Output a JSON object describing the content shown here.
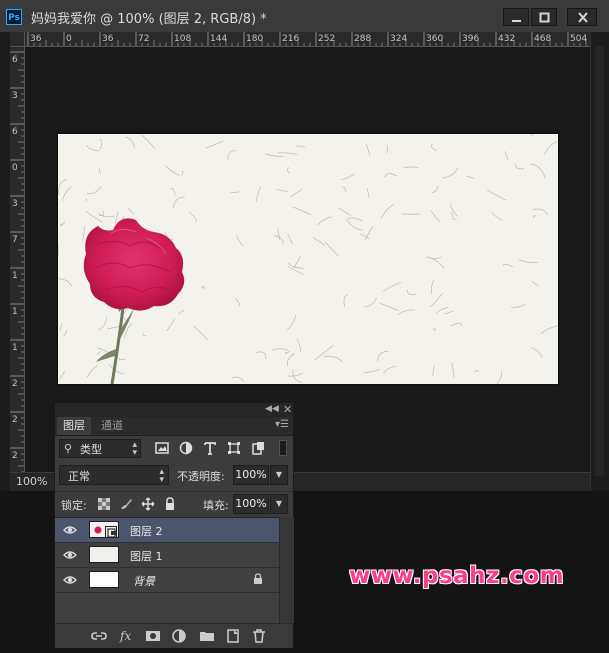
{
  "window": {
    "app_badge": "Ps",
    "title": "妈妈我爱你 @ 100% (图层 2, RGB/8) *"
  },
  "rulers": {
    "horizontal": [
      "36",
      "0",
      "36",
      "72",
      "108",
      "144",
      "180",
      "216",
      "252",
      "288",
      "324",
      "360",
      "396",
      "432",
      "468",
      "504"
    ],
    "vertical": [
      "6",
      "3",
      "6",
      "0",
      "3",
      "7",
      "1",
      "1",
      "1",
      "2",
      "2",
      "2",
      "3"
    ]
  },
  "status": {
    "zoom": "100%"
  },
  "layers_panel": {
    "tabs": [
      {
        "label": "图层",
        "active": true
      },
      {
        "label": "通道",
        "active": false
      }
    ],
    "filter": {
      "label": "类型"
    },
    "blend_mode": "正常",
    "opacity_label": "不透明度:",
    "opacity_value": "100%",
    "lock_label": "锁定:",
    "fill_label": "填充:",
    "fill_value": "100%",
    "layers": [
      {
        "name": "图层 2",
        "selected": true,
        "visible": true,
        "smart_object": true
      },
      {
        "name": "图层 1",
        "selected": false,
        "visible": true
      },
      {
        "name": "背景",
        "selected": false,
        "visible": true,
        "locked": true
      }
    ]
  },
  "watermark": "www.psahz.com"
}
